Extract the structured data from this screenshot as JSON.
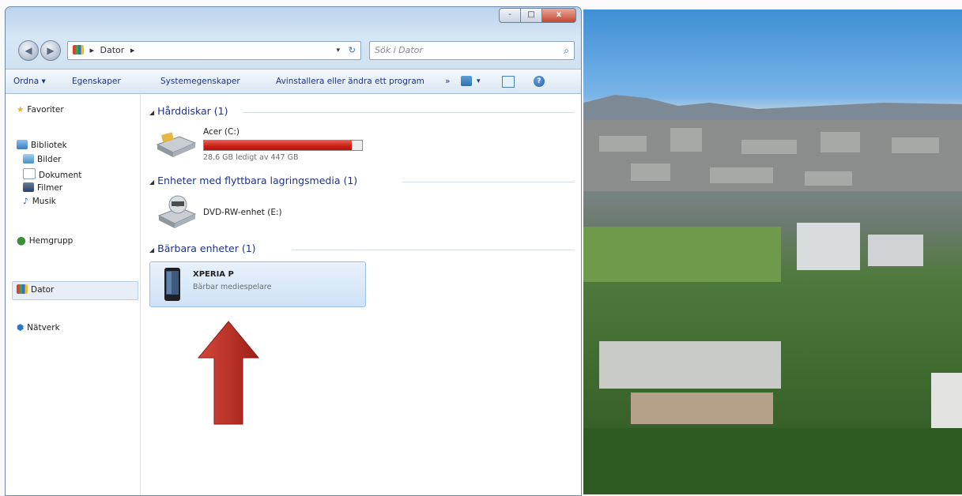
{
  "window": {
    "caption_buttons": {
      "minimize": "-",
      "maximize": "□",
      "close": "x"
    },
    "address": {
      "segments": [
        "Dator"
      ],
      "separator": "▸",
      "dropdown": "▾",
      "refresh": "↻"
    },
    "search": {
      "placeholder": "Sök i Dator",
      "icon": "magnifier-icon"
    }
  },
  "toolbar": {
    "organize": "Ordna ▾",
    "properties": "Egenskaper",
    "system_properties": "Systemegenskaper",
    "uninstall": "Avinstallera eller ändra ett program",
    "more": "»"
  },
  "nav": {
    "favorites": "Favoriter",
    "libraries": "Bibliotek",
    "lib_items": [
      "Bilder",
      "Dokument",
      "Filmer",
      "Musik"
    ],
    "homegroup": "Hemgrupp",
    "computer": "Dator",
    "network": "Nätverk"
  },
  "groups": {
    "hdd": "Hårddiskar (1)",
    "removable": "Enheter med flyttbara lagringsmedia (1)",
    "portable": "Bärbara enheter (1)"
  },
  "items": {
    "drive_c": {
      "name": "Acer (C:)",
      "free": "28,6 GB ledigt av 447 GB",
      "used_fraction": 0.936
    },
    "dvd": {
      "name": "DVD-RW-enhet (E:)"
    },
    "phone": {
      "name": "XPERIA P",
      "type": "Bärbar mediespelare"
    }
  },
  "colors": {
    "accent": "#1e3287",
    "drive_bar": "#c81e14",
    "arrow": "#b0271f",
    "selection": "#cfe2f6"
  }
}
